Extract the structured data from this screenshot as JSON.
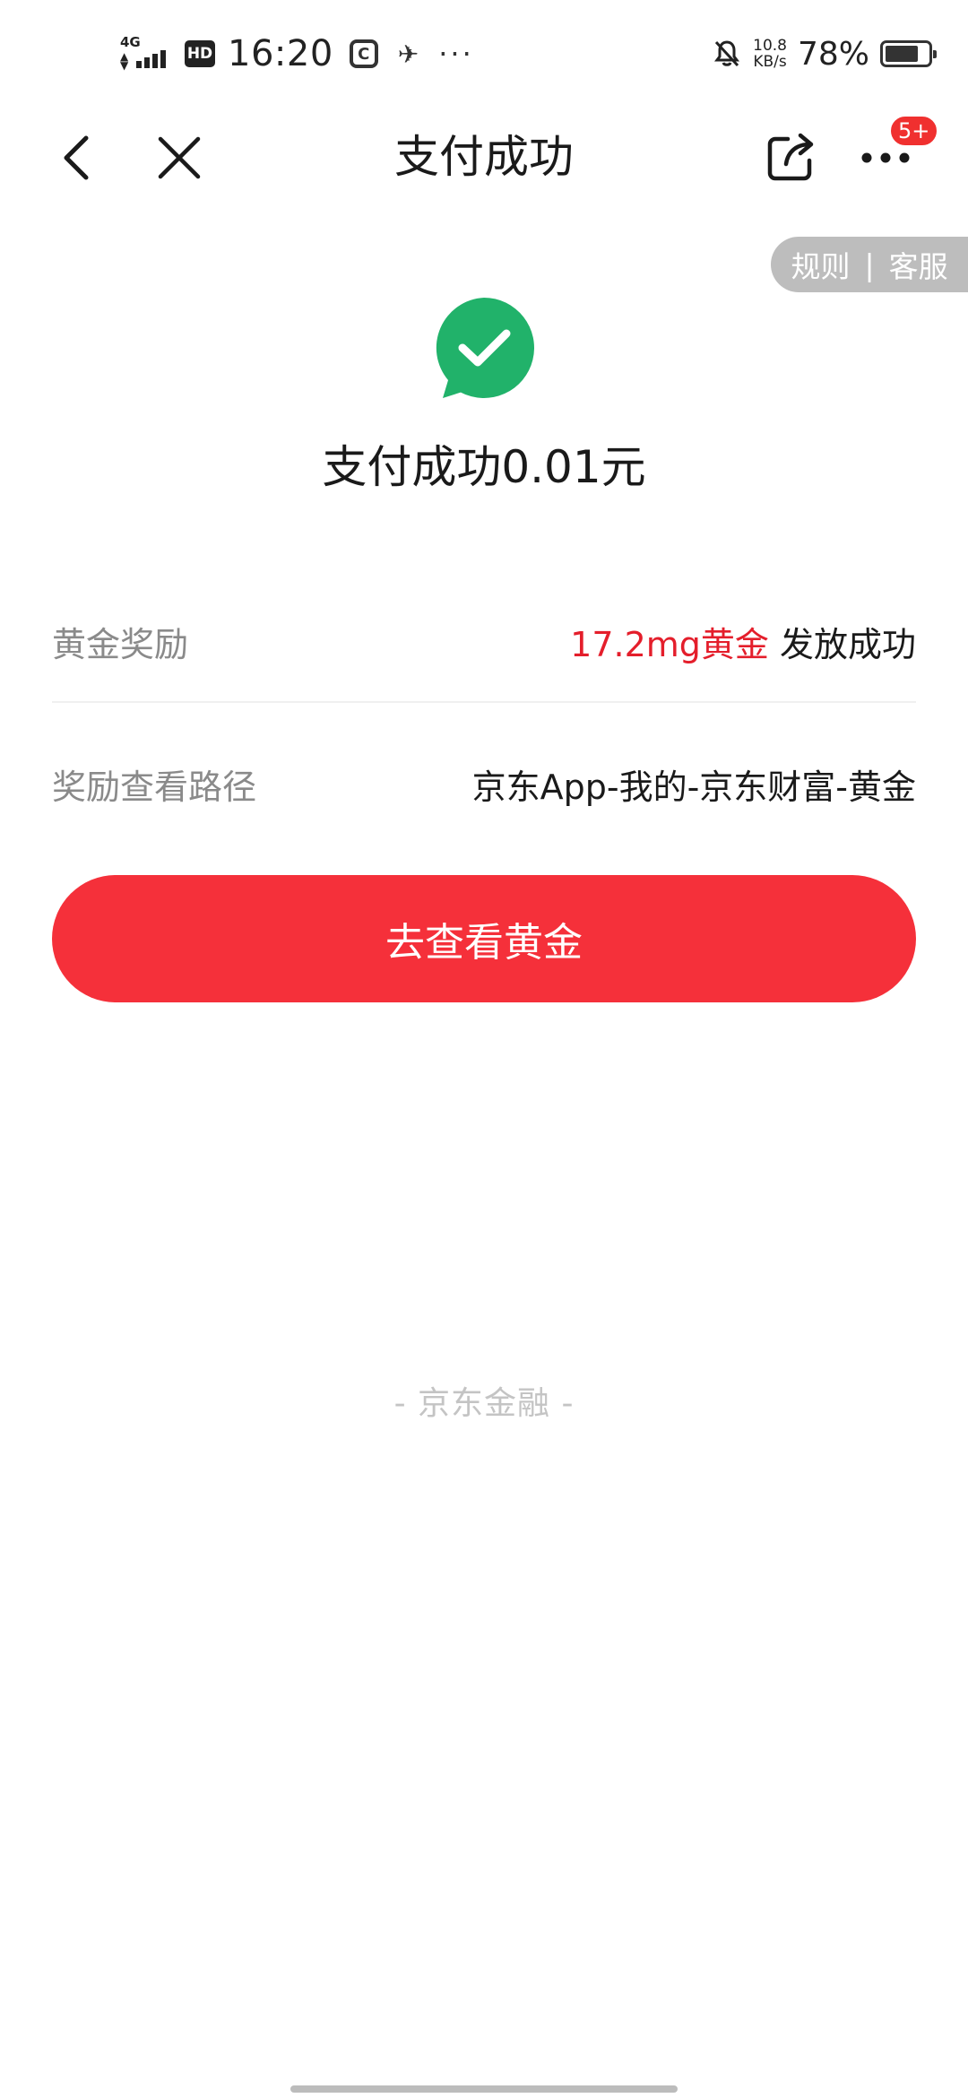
{
  "status_bar": {
    "network": "4G",
    "hd": "HD",
    "time": "16:20",
    "more": "···",
    "speed_value": "10.8",
    "speed_unit": "KB/s",
    "battery_percent": "78%",
    "battery_level": 0.78
  },
  "nav": {
    "title": "支付成功",
    "badge": "5+"
  },
  "rules": {
    "rules_label": "规则",
    "separator": "|",
    "service_label": "客服"
  },
  "success": {
    "message": "支付成功0.01元",
    "icon_color": "#21b26a"
  },
  "reward_row": {
    "label": "黄金奖励",
    "highlight": "17.2mg黄金",
    "status": " 发放成功"
  },
  "path_row": {
    "label": "奖励查看路径",
    "value": "京东App-我的-京东财富-黄金"
  },
  "action": {
    "button_label": "去查看黄金",
    "color": "#f5303a"
  },
  "footer": {
    "text": "- 京东金融 -"
  }
}
